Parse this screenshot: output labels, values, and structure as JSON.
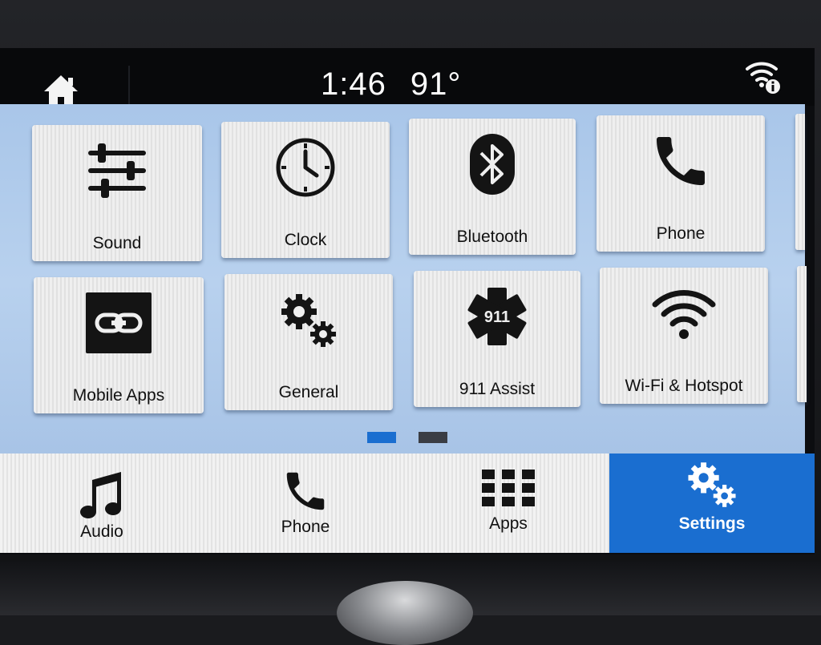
{
  "status": {
    "time": "1:46",
    "temperature": "91°"
  },
  "icons": {
    "home": "home-icon",
    "wifi_status": "wifi-info-icon"
  },
  "colors": {
    "active_tab": "#1a6ed0",
    "content_bg": "#b0cbec",
    "page_indicator_active": "#1a6ed0",
    "page_indicator_inactive": "#3a3d44"
  },
  "settings_tiles": [
    {
      "label": "Sound",
      "icon": "sliders-icon"
    },
    {
      "label": "Clock",
      "icon": "clock-icon"
    },
    {
      "label": "Bluetooth",
      "icon": "bluetooth-icon"
    },
    {
      "label": "Phone",
      "icon": "phone-icon"
    },
    {
      "label": "Mobile Apps",
      "icon": "link-icon"
    },
    {
      "label": "General",
      "icon": "gears-icon"
    },
    {
      "label": "911 Assist",
      "icon": "star-of-life-icon",
      "badge": "911"
    },
    {
      "label": "Wi-Fi & Hotspot",
      "icon": "wifi-icon"
    }
  ],
  "pagination": {
    "current_page": 1,
    "total_pages": 2
  },
  "bottom_nav": [
    {
      "label": "Audio",
      "icon": "music-note-icon",
      "active": false
    },
    {
      "label": "Phone",
      "icon": "phone-icon",
      "active": false
    },
    {
      "label": "Apps",
      "icon": "apps-grid-icon",
      "active": false
    },
    {
      "label": "Settings",
      "icon": "gears-icon",
      "active": true
    }
  ]
}
